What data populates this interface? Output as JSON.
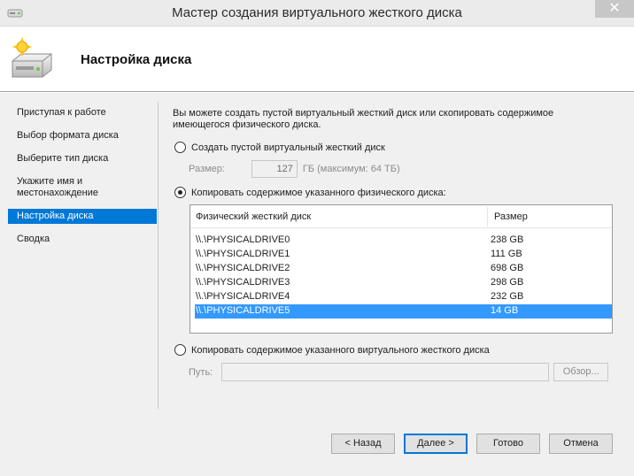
{
  "window": {
    "title": "Мастер создания виртуального жесткого диска",
    "close_glyph": "✕"
  },
  "header": {
    "title": "Настройка диска",
    "icon": "hard-disk-wizard-icon"
  },
  "nav": {
    "items": [
      {
        "label": "Приступая к работе",
        "active": false
      },
      {
        "label": "Выбор формата диска",
        "active": false
      },
      {
        "label": "Выберите тип диска",
        "active": false
      },
      {
        "label": "Укажите имя и местонахождение",
        "active": false
      },
      {
        "label": "Настройка диска",
        "active": true
      },
      {
        "label": "Сводка",
        "active": false
      }
    ]
  },
  "main": {
    "description": "Вы можете создать пустой виртуальный жесткий диск или скопировать содержимое имеющегося физического диска.",
    "option_empty": {
      "label": "Создать пустой виртуальный жесткий диск",
      "checked": false
    },
    "size": {
      "label": "Размер:",
      "value": "127",
      "unit": "ГБ (максимум: 64 ТБ)"
    },
    "option_physical": {
      "label": "Копировать содержимое указанного физического диска:",
      "checked": true
    },
    "table": {
      "columns": [
        "Физический жесткий диск",
        "Размер"
      ],
      "rows": [
        {
          "name": "\\\\.\\PHYSICALDRIVE0",
          "size": "238 GB",
          "selected": false
        },
        {
          "name": "\\\\.\\PHYSICALDRIVE1",
          "size": "111 GB",
          "selected": false
        },
        {
          "name": "\\\\.\\PHYSICALDRIVE2",
          "size": "698 GB",
          "selected": false
        },
        {
          "name": "\\\\.\\PHYSICALDRIVE3",
          "size": "298 GB",
          "selected": false
        },
        {
          "name": "\\\\.\\PHYSICALDRIVE4",
          "size": "232 GB",
          "selected": false
        },
        {
          "name": "\\\\.\\PHYSICALDRIVE5",
          "size": "14 GB",
          "selected": true
        }
      ]
    },
    "option_virtual": {
      "label": "Копировать содержимое указанного виртуального жесткого диска",
      "checked": false
    },
    "path": {
      "label": "Путь:",
      "value": "",
      "browse_label": "Обзор..."
    }
  },
  "footer": {
    "back_label": "< Назад",
    "next_label": "Далее >",
    "finish_label": "Готово",
    "cancel_label": "Отмена"
  },
  "colors": {
    "accent": "#0078d7",
    "selection": "#3399ff",
    "background": "#f0f0f0"
  }
}
